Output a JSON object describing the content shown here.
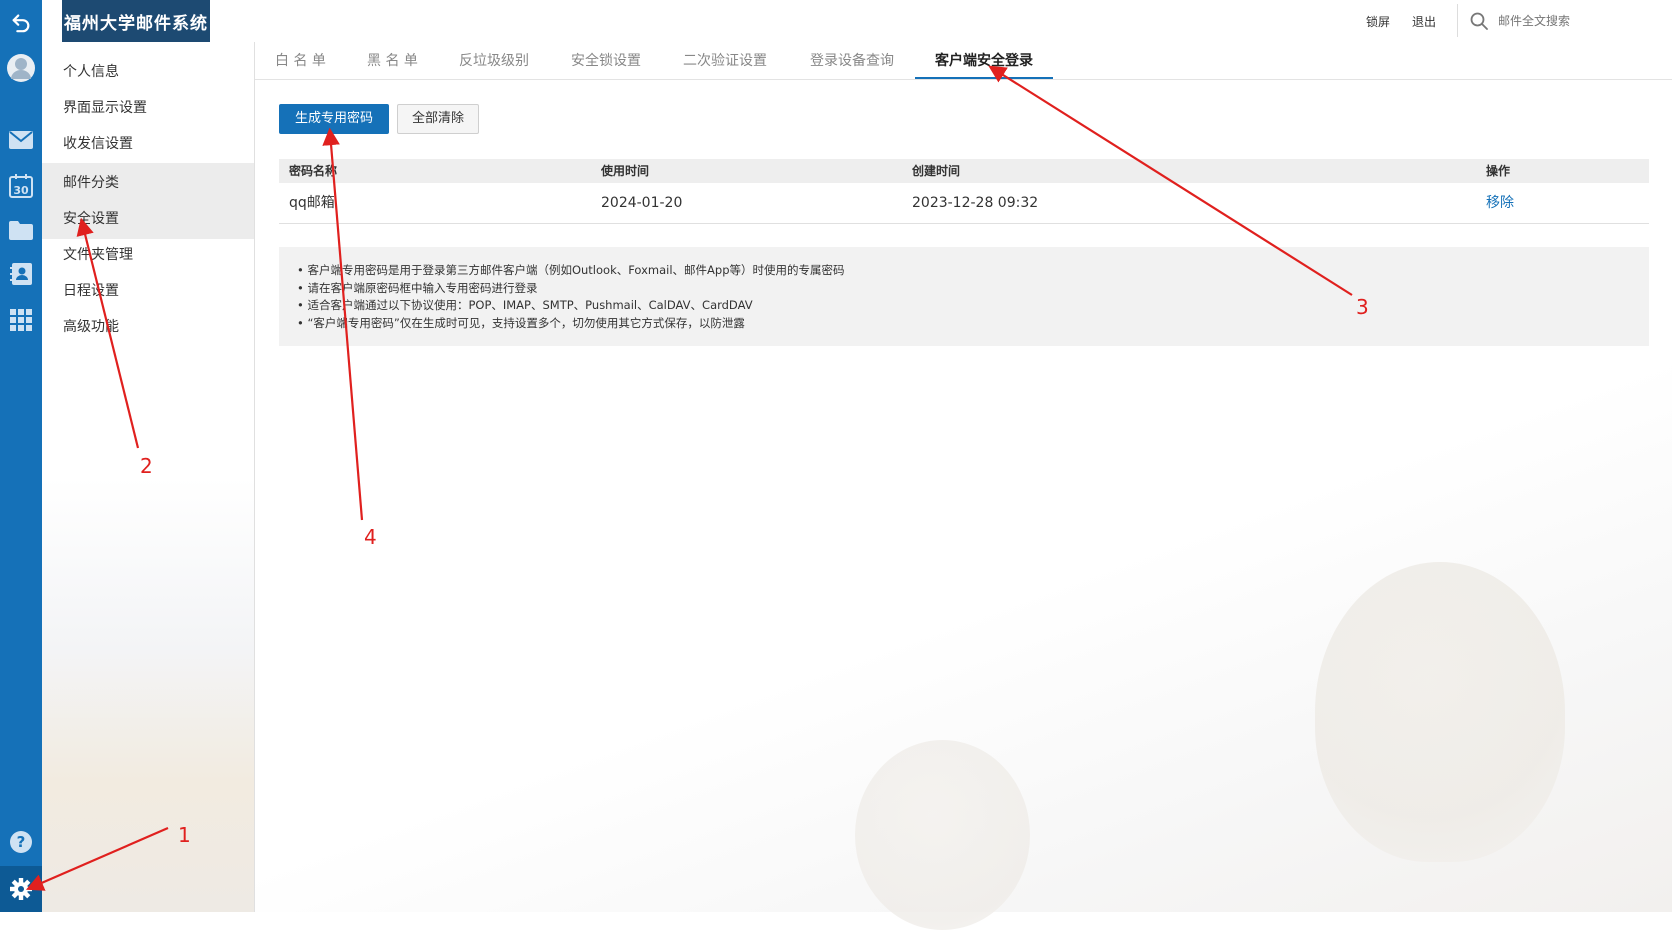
{
  "header": {
    "logo_text": "福州大学邮件系统",
    "lock_label": "锁屏",
    "logout_label": "退出",
    "search_placeholder": "邮件全文搜索"
  },
  "rail": {
    "icons": [
      "undo-icon",
      "avatar-icon",
      "mail-icon",
      "calendar-icon",
      "folder-icon",
      "contacts-icon",
      "apps-icon",
      "help-icon",
      "gear-icon"
    ],
    "calendar_number": "30",
    "accent": "#1571b8"
  },
  "sidenav": {
    "items": [
      {
        "label": "个人信息"
      },
      {
        "label": "界面显示设置"
      },
      {
        "label": "收发信设置"
      },
      {
        "label": "邮件分类"
      },
      {
        "label": "安全设置"
      },
      {
        "label": "文件夹管理"
      },
      {
        "label": "日程设置"
      },
      {
        "label": "高级功能"
      }
    ]
  },
  "tabs": [
    {
      "label": "白 名 单"
    },
    {
      "label": "黑 名 单"
    },
    {
      "label": "反垃圾级别"
    },
    {
      "label": "安全锁设置"
    },
    {
      "label": "二次验证设置"
    },
    {
      "label": "登录设备查询"
    },
    {
      "label": "客户端安全登录"
    }
  ],
  "actions": {
    "generate_label": "生成专用密码",
    "clear_label": "全部清除"
  },
  "table": {
    "headers": [
      "密码名称",
      "使用时间",
      "创建时间",
      "操作"
    ],
    "rows": [
      {
        "name": "qq邮箱",
        "used": "2024-01-20",
        "created": "2023-12-28 09:32",
        "op": "移除"
      }
    ]
  },
  "notes": [
    "客户端专用密码是用于登录第三方邮件客户端（例如Outlook、Foxmail、邮件App等）时使用的专属密码",
    "请在客户端原密码框中输入专用密码进行登录",
    "适合客户端通过以下协议使用：POP、IMAP、SMTP、Pushmail、CalDAV、CardDAV",
    "“客户端专用密码”仅在生成时可见，支持设置多个，切勿使用其它方式保存，以防泄露"
  ],
  "annotations": {
    "labels": [
      "1",
      "2",
      "3",
      "4"
    ],
    "color": "#e0201e"
  }
}
